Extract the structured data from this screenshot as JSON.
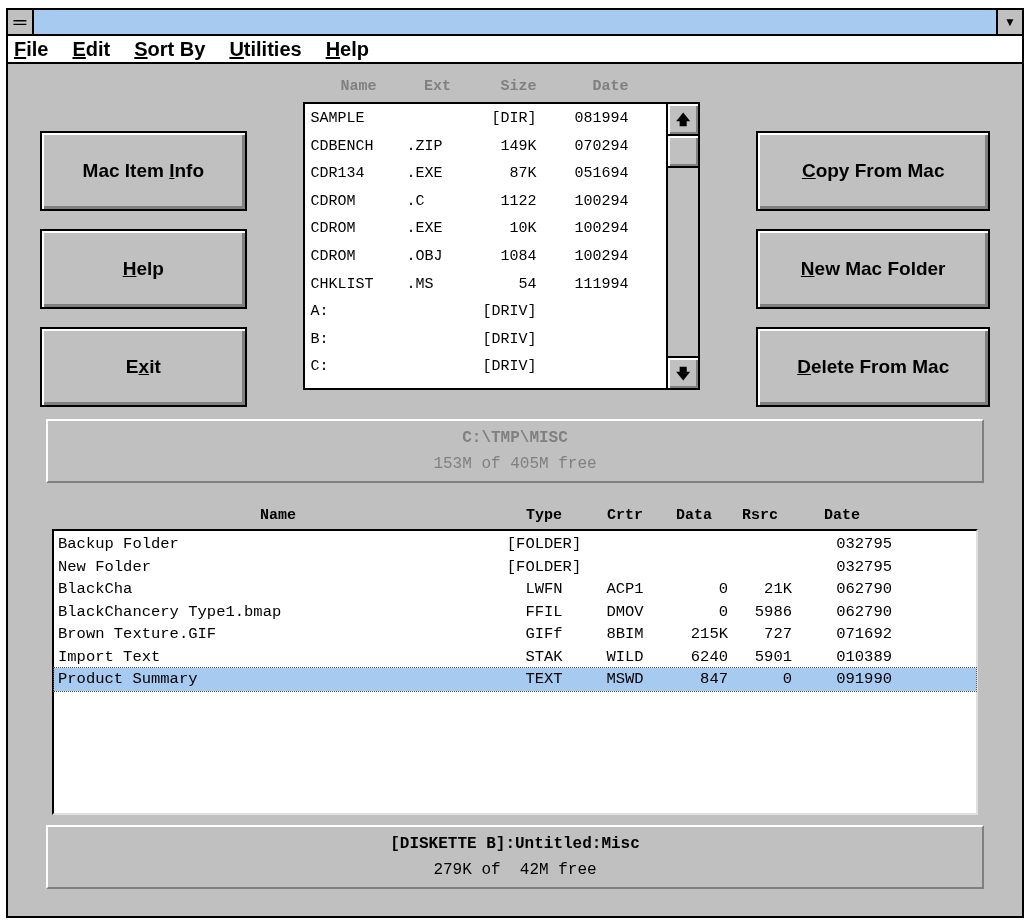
{
  "window": {
    "control_menu": "═",
    "dropdown": "▼"
  },
  "menu": [
    {
      "key": "F",
      "after": "ile"
    },
    {
      "key": "E",
      "after": "dit"
    },
    {
      "key": "S",
      "after": "ort By"
    },
    {
      "key": "U",
      "after": "tilities"
    },
    {
      "key": "H",
      "after": "elp"
    }
  ],
  "left_buttons": [
    {
      "before": "Mac Item ",
      "key": "I",
      "after": "nfo"
    },
    {
      "key": "H",
      "after": "elp"
    },
    {
      "before": "E",
      "key": "x",
      "after": "it"
    }
  ],
  "right_buttons": [
    {
      "key": "C",
      "after": "opy From Mac"
    },
    {
      "key": "N",
      "after": "ew Mac Folder"
    },
    {
      "key": "D",
      "after": "elete From Mac"
    }
  ],
  "pc_list": {
    "columns": [
      "Name",
      "Ext",
      "Size",
      "Date"
    ],
    "rows": [
      {
        "name": "SAMPLE",
        "size": "[DIR]",
        "date": "081994"
      },
      {
        "name": "CDBENCH",
        "ext": ".ZIP",
        "size": "149K",
        "date": "070294"
      },
      {
        "name": "CDR134",
        "ext": ".EXE",
        "size": "87K",
        "date": "051694"
      },
      {
        "name": "CDROM",
        "ext": ".C",
        "size": "1122",
        "date": "100294"
      },
      {
        "name": "CDROM",
        "ext": ".EXE",
        "size": "10K",
        "date": "100294"
      },
      {
        "name": "CDROM",
        "ext": ".OBJ",
        "size": "1084",
        "date": "100294"
      },
      {
        "name": "CHKLIST",
        "ext": ".MS",
        "size": "54",
        "date": "111994"
      },
      {
        "name": "A:",
        "size": "[DRIV]"
      },
      {
        "name": "B:",
        "size": "[DRIV]"
      },
      {
        "name": "C:",
        "size": "[DRIV]"
      }
    ],
    "scroll_up": "🡅",
    "scroll_down": "🡇"
  },
  "pc_path": {
    "path": "C:\\TMP\\MISC",
    "free": "153M of 405M free",
    "disabled": true
  },
  "mac_list": {
    "columns": [
      "Name",
      "Type",
      "Crtr",
      "Data",
      "Rsrc",
      "Date"
    ],
    "rows": [
      {
        "name": "Backup Folder",
        "type": "[FOLDER]",
        "date": "032795",
        "selected": false
      },
      {
        "name": "New Folder",
        "type": "[FOLDER]",
        "date": "032795",
        "selected": false
      },
      {
        "name": "BlackCha",
        "type": "LWFN",
        "crtr": "ACP1",
        "data": "0",
        "rsrc": "21K",
        "date": "062790",
        "selected": false
      },
      {
        "name": "BlackChancery Type1.bmap",
        "type": "FFIL",
        "crtr": "DMOV",
        "data": "0",
        "rsrc": "5986",
        "date": "062790",
        "selected": false
      },
      {
        "name": "Brown Texture.GIF",
        "type": "GIFf",
        "crtr": "8BIM",
        "data": "215K",
        "rsrc": "727",
        "date": "071692",
        "selected": false
      },
      {
        "name": "Import Text",
        "type": "STAK",
        "crtr": "WILD",
        "data": "6240",
        "rsrc": "5901",
        "date": "010389",
        "selected": false
      },
      {
        "name": "Product Summary",
        "type": "TEXT",
        "crtr": "MSWD",
        "data": "847",
        "rsrc": "0",
        "date": "091990",
        "selected": true
      }
    ]
  },
  "mac_path": {
    "path": "[DISKETTE B]:Untitled:Misc",
    "free": "279K of  42M free",
    "disabled": false
  }
}
